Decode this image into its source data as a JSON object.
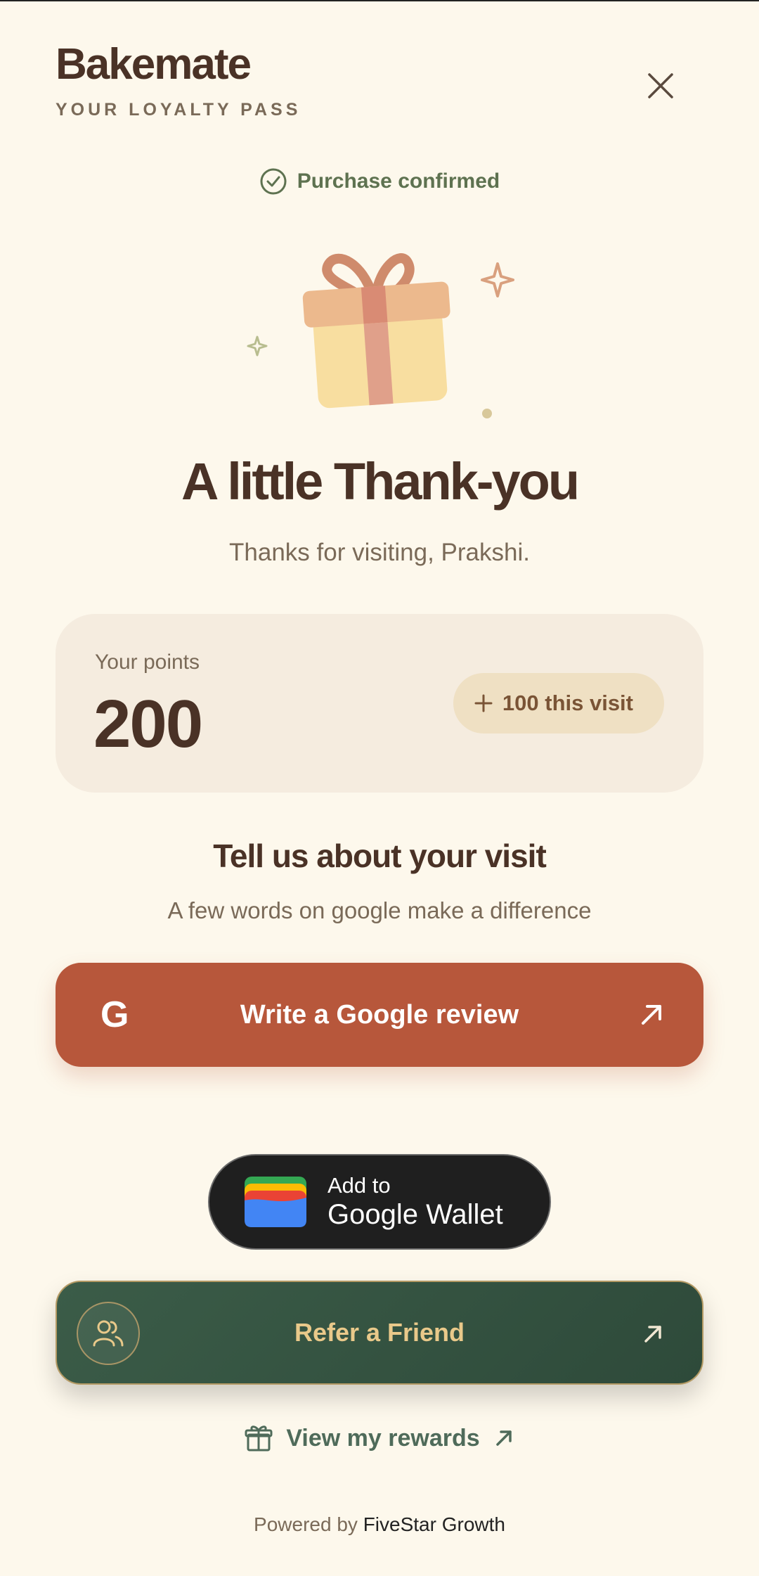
{
  "brand": {
    "name": "Bakemate",
    "subtitle": "YOUR LOYALTY PASS"
  },
  "status": {
    "text": "Purchase confirmed",
    "icon": "check-circle-icon"
  },
  "hero": {
    "title": "A little Thank-you",
    "subtitle": "Thanks for visiting, Prakshi."
  },
  "points": {
    "label": "Your points",
    "value": "200",
    "delta": "100 this visit"
  },
  "review": {
    "title": "Tell us about your visit",
    "subtitle": "A few words on google make a difference",
    "button_letter": "G",
    "button_label": "Write a Google review"
  },
  "wallet": {
    "line1": "Add to",
    "line2": "Google Wallet"
  },
  "refer": {
    "label": "Refer a Friend"
  },
  "rewards": {
    "label": "View my rewards"
  },
  "footer": {
    "prefix": "Powered by",
    "brand": "FiveStar Growth"
  },
  "colors": {
    "background": "#fdf8ec",
    "text_dark": "#4a3226",
    "accent_review": "#b7573b",
    "accent_refer": "#2e4a3a",
    "accent_green_text": "#5e7250",
    "gold": "#e9c98a"
  }
}
